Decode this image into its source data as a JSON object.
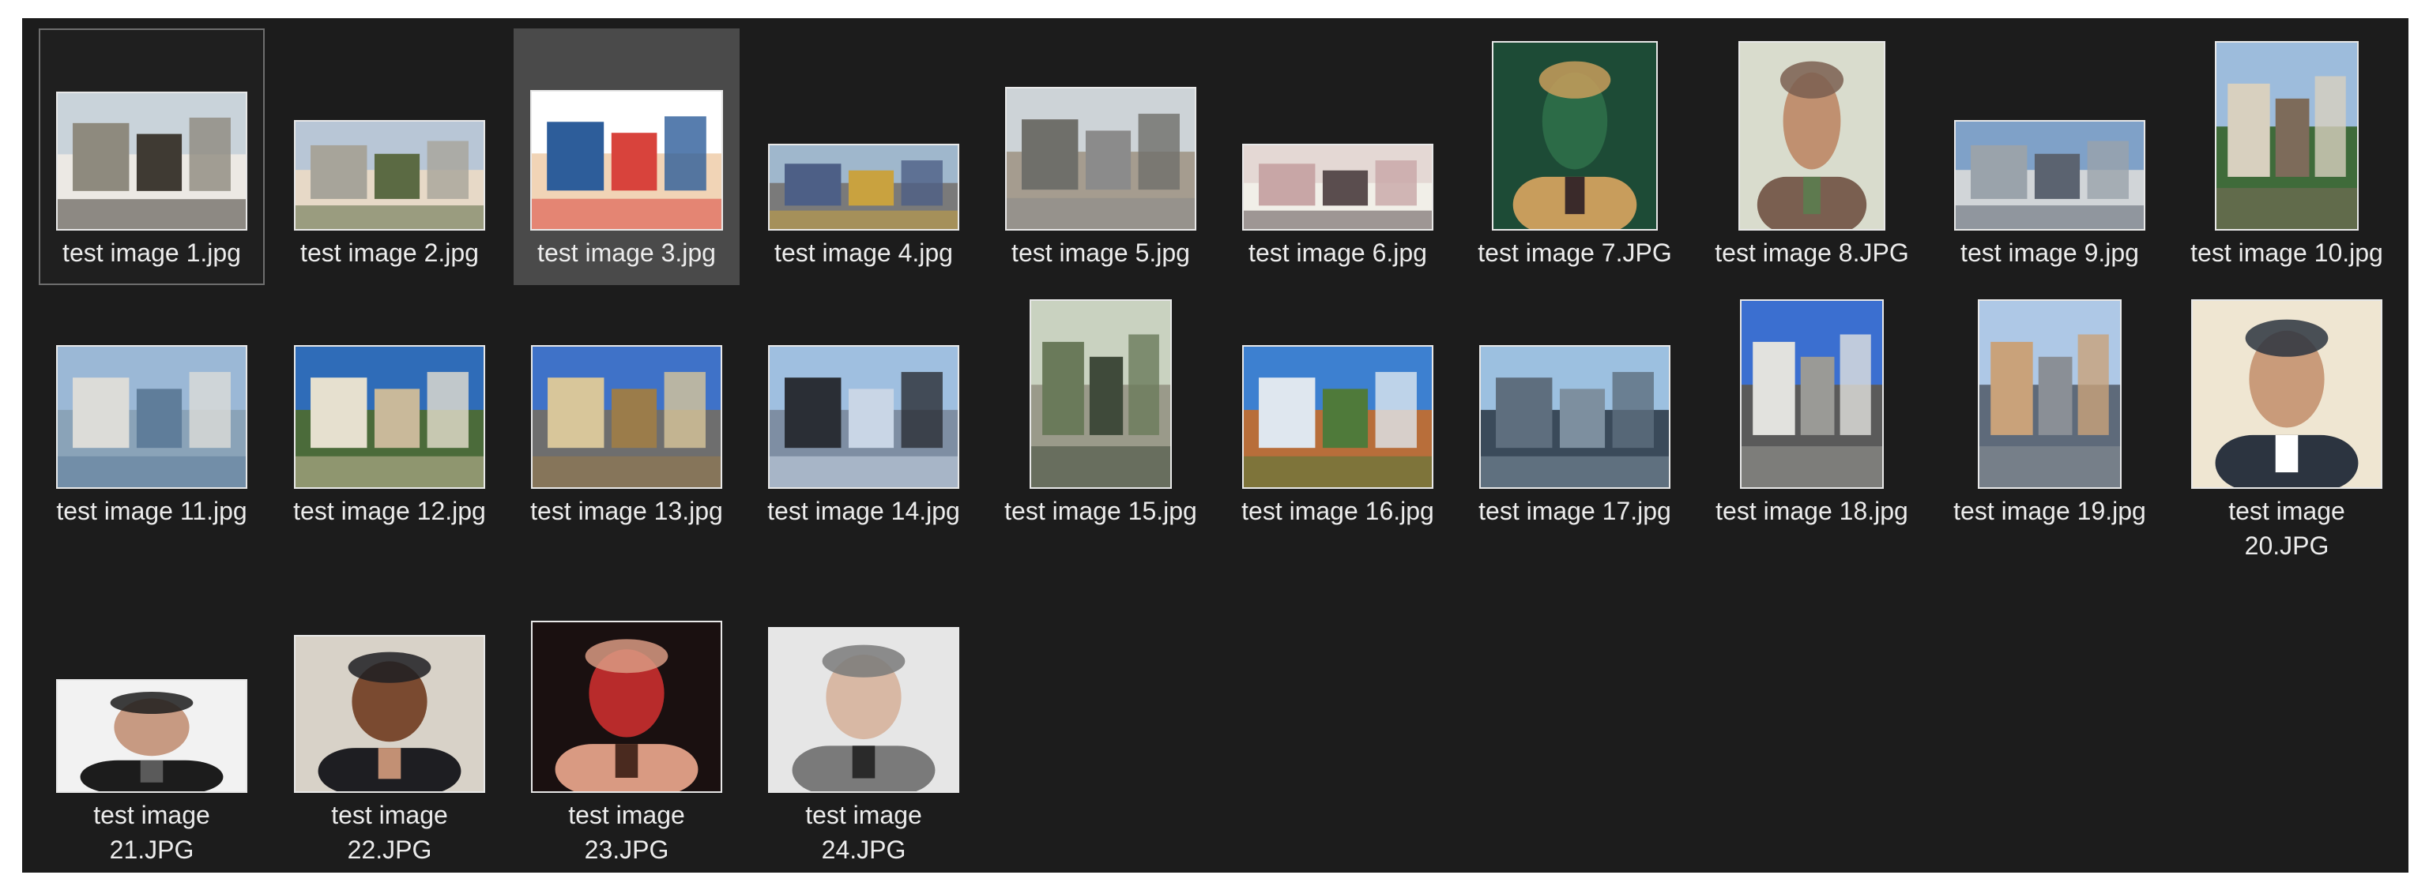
{
  "files": [
    {
      "name": "test image 1.jpg",
      "thumbnail_icon": "house-photo-icon"
    },
    {
      "name": "test image 2.jpg",
      "thumbnail_icon": "city-skyline-photo-icon"
    },
    {
      "name": "test image 3.jpg",
      "thumbnail_icon": "people-screenshot-photo-icon"
    },
    {
      "name": "test image 4.jpg",
      "thumbnail_icon": "street-building-photo-icon"
    },
    {
      "name": "test image 5.jpg",
      "thumbnail_icon": "canal-street-photo-icon"
    },
    {
      "name": "test image 6.jpg",
      "thumbnail_icon": "storefront-photo-icon"
    },
    {
      "name": "test image 7.JPG",
      "thumbnail_icon": "woman-interior-photo-icon"
    },
    {
      "name": "test image 8.JPG",
      "thumbnail_icon": "man-portrait-photo-icon"
    },
    {
      "name": "test image 9.jpg",
      "thumbnail_icon": "city-aerial-photo-icon"
    },
    {
      "name": "test image 10.jpg",
      "thumbnail_icon": "church-tower-photo-icon"
    },
    {
      "name": "test image 11.jpg",
      "thumbnail_icon": "harbor-dome-photo-icon"
    },
    {
      "name": "test image 12.jpg",
      "thumbnail_icon": "palace-photo-icon"
    },
    {
      "name": "test image 13.jpg",
      "thumbnail_icon": "mansion-photo-icon"
    },
    {
      "name": "test image 14.jpg",
      "thumbnail_icon": "opera-house-water-photo-icon"
    },
    {
      "name": "test image 15.jpg",
      "thumbnail_icon": "street-trees-photo-icon"
    },
    {
      "name": "test image 16.jpg",
      "thumbnail_icon": "riverside-town-photo-icon"
    },
    {
      "name": "test image 17.jpg",
      "thumbnail_icon": "river-skyline-photo-icon"
    },
    {
      "name": "test image 18.jpg",
      "thumbnail_icon": "ornate-building-photo-icon"
    },
    {
      "name": "test image 19.jpg",
      "thumbnail_icon": "colorful-street-photo-icon"
    },
    {
      "name": "test image\n20.JPG",
      "thumbnail_icon": "man-suit-portrait-photo-icon"
    },
    {
      "name": "test image\n21.JPG",
      "thumbnail_icon": "man-glasses-portrait-photo-icon"
    },
    {
      "name": "test image\n22.JPG",
      "thumbnail_icon": "young-man-curly-portrait-photo-icon"
    },
    {
      "name": "test image\n23.JPG",
      "thumbnail_icon": "woman-smiling-portrait-photo-icon"
    },
    {
      "name": "test image\n24.JPG",
      "thumbnail_icon": "older-man-glasses-portrait-photo-icon"
    }
  ],
  "state": {
    "focused_item": "test image 1.jpg",
    "selected_item": "test image 3.jpg"
  },
  "colors": {
    "background": "#1c1c1c",
    "selection": "#4a4a4a",
    "focus_border": "#6e6e6e",
    "text": "#ececec"
  }
}
